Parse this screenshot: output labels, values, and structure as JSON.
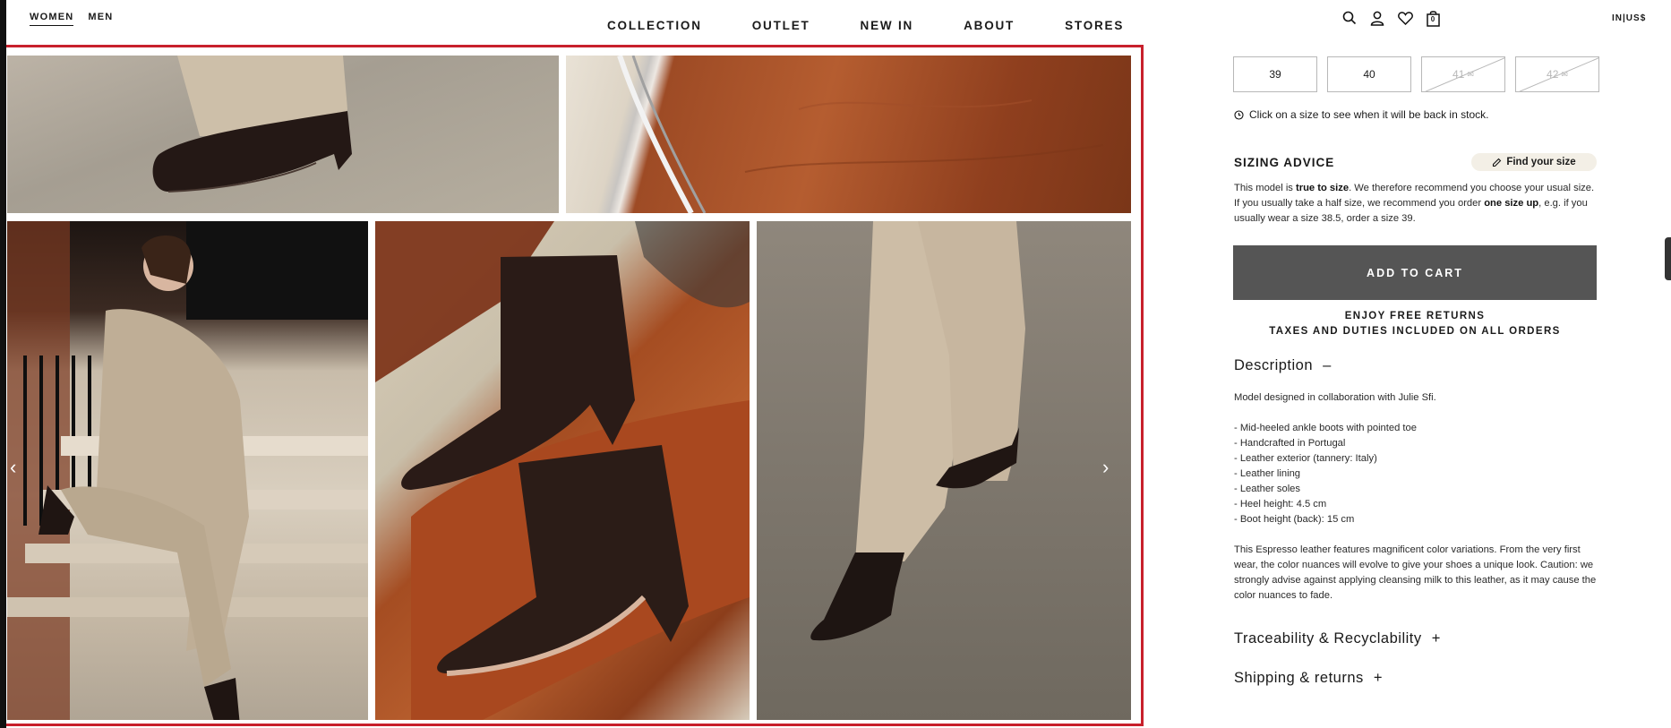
{
  "header": {
    "gender_tabs": [
      "WOMEN",
      "MEN"
    ],
    "nav": [
      "COLLECTION",
      "OUTLET",
      "NEW IN",
      "ABOUT",
      "STORES"
    ],
    "cart_count": "0",
    "locale": "IN|US$"
  },
  "gallery": {
    "prev_arrow": "‹",
    "next_arrow": "›"
  },
  "sizes": {
    "available": [
      "39",
      "40"
    ],
    "unavailable": [
      "41",
      "42"
    ],
    "mail_glyph": "✉",
    "stock_note": "Click on a size to see when it will be back in stock."
  },
  "sizing": {
    "title": "SIZING ADVICE",
    "find_size": "Find your size",
    "text_1": "This model is ",
    "bold_1": "true to size",
    "text_2": ". We therefore recommend you choose your usual size. If you usually take a half size, we recommend you order ",
    "bold_2": "one size up",
    "text_3": ", e.g. if you usually wear a size 38.5, order a size 39."
  },
  "cart": {
    "add_label": "ADD TO CART",
    "returns": "ENJOY FREE RETURNS",
    "taxes": "TAXES AND DUTIES INCLUDED ON ALL ORDERS"
  },
  "description": {
    "title": "Description",
    "toggle": "–",
    "intro": "Model designed in collaboration with Julie Sfi.",
    "features": [
      "- Mid-heeled ankle boots with pointed toe",
      "- Handcrafted in Portugal",
      "- Leather exterior (tannery: Italy)",
      "- Leather lining",
      "- Leather soles",
      "- Heel height: 4.5 cm",
      "- Boot height (back): 15 cm"
    ],
    "care": "This Espresso leather features magnificent color variations. From the very first wear, the color nuances will evolve to give your shoes a unique look. Caution: we strongly advise against applying cleansing milk to this leather, as it may cause the color nuances to fade."
  },
  "accordions": {
    "traceability": "Traceability & Recyclability",
    "shipping": "Shipping & returns",
    "toggle": "+"
  }
}
